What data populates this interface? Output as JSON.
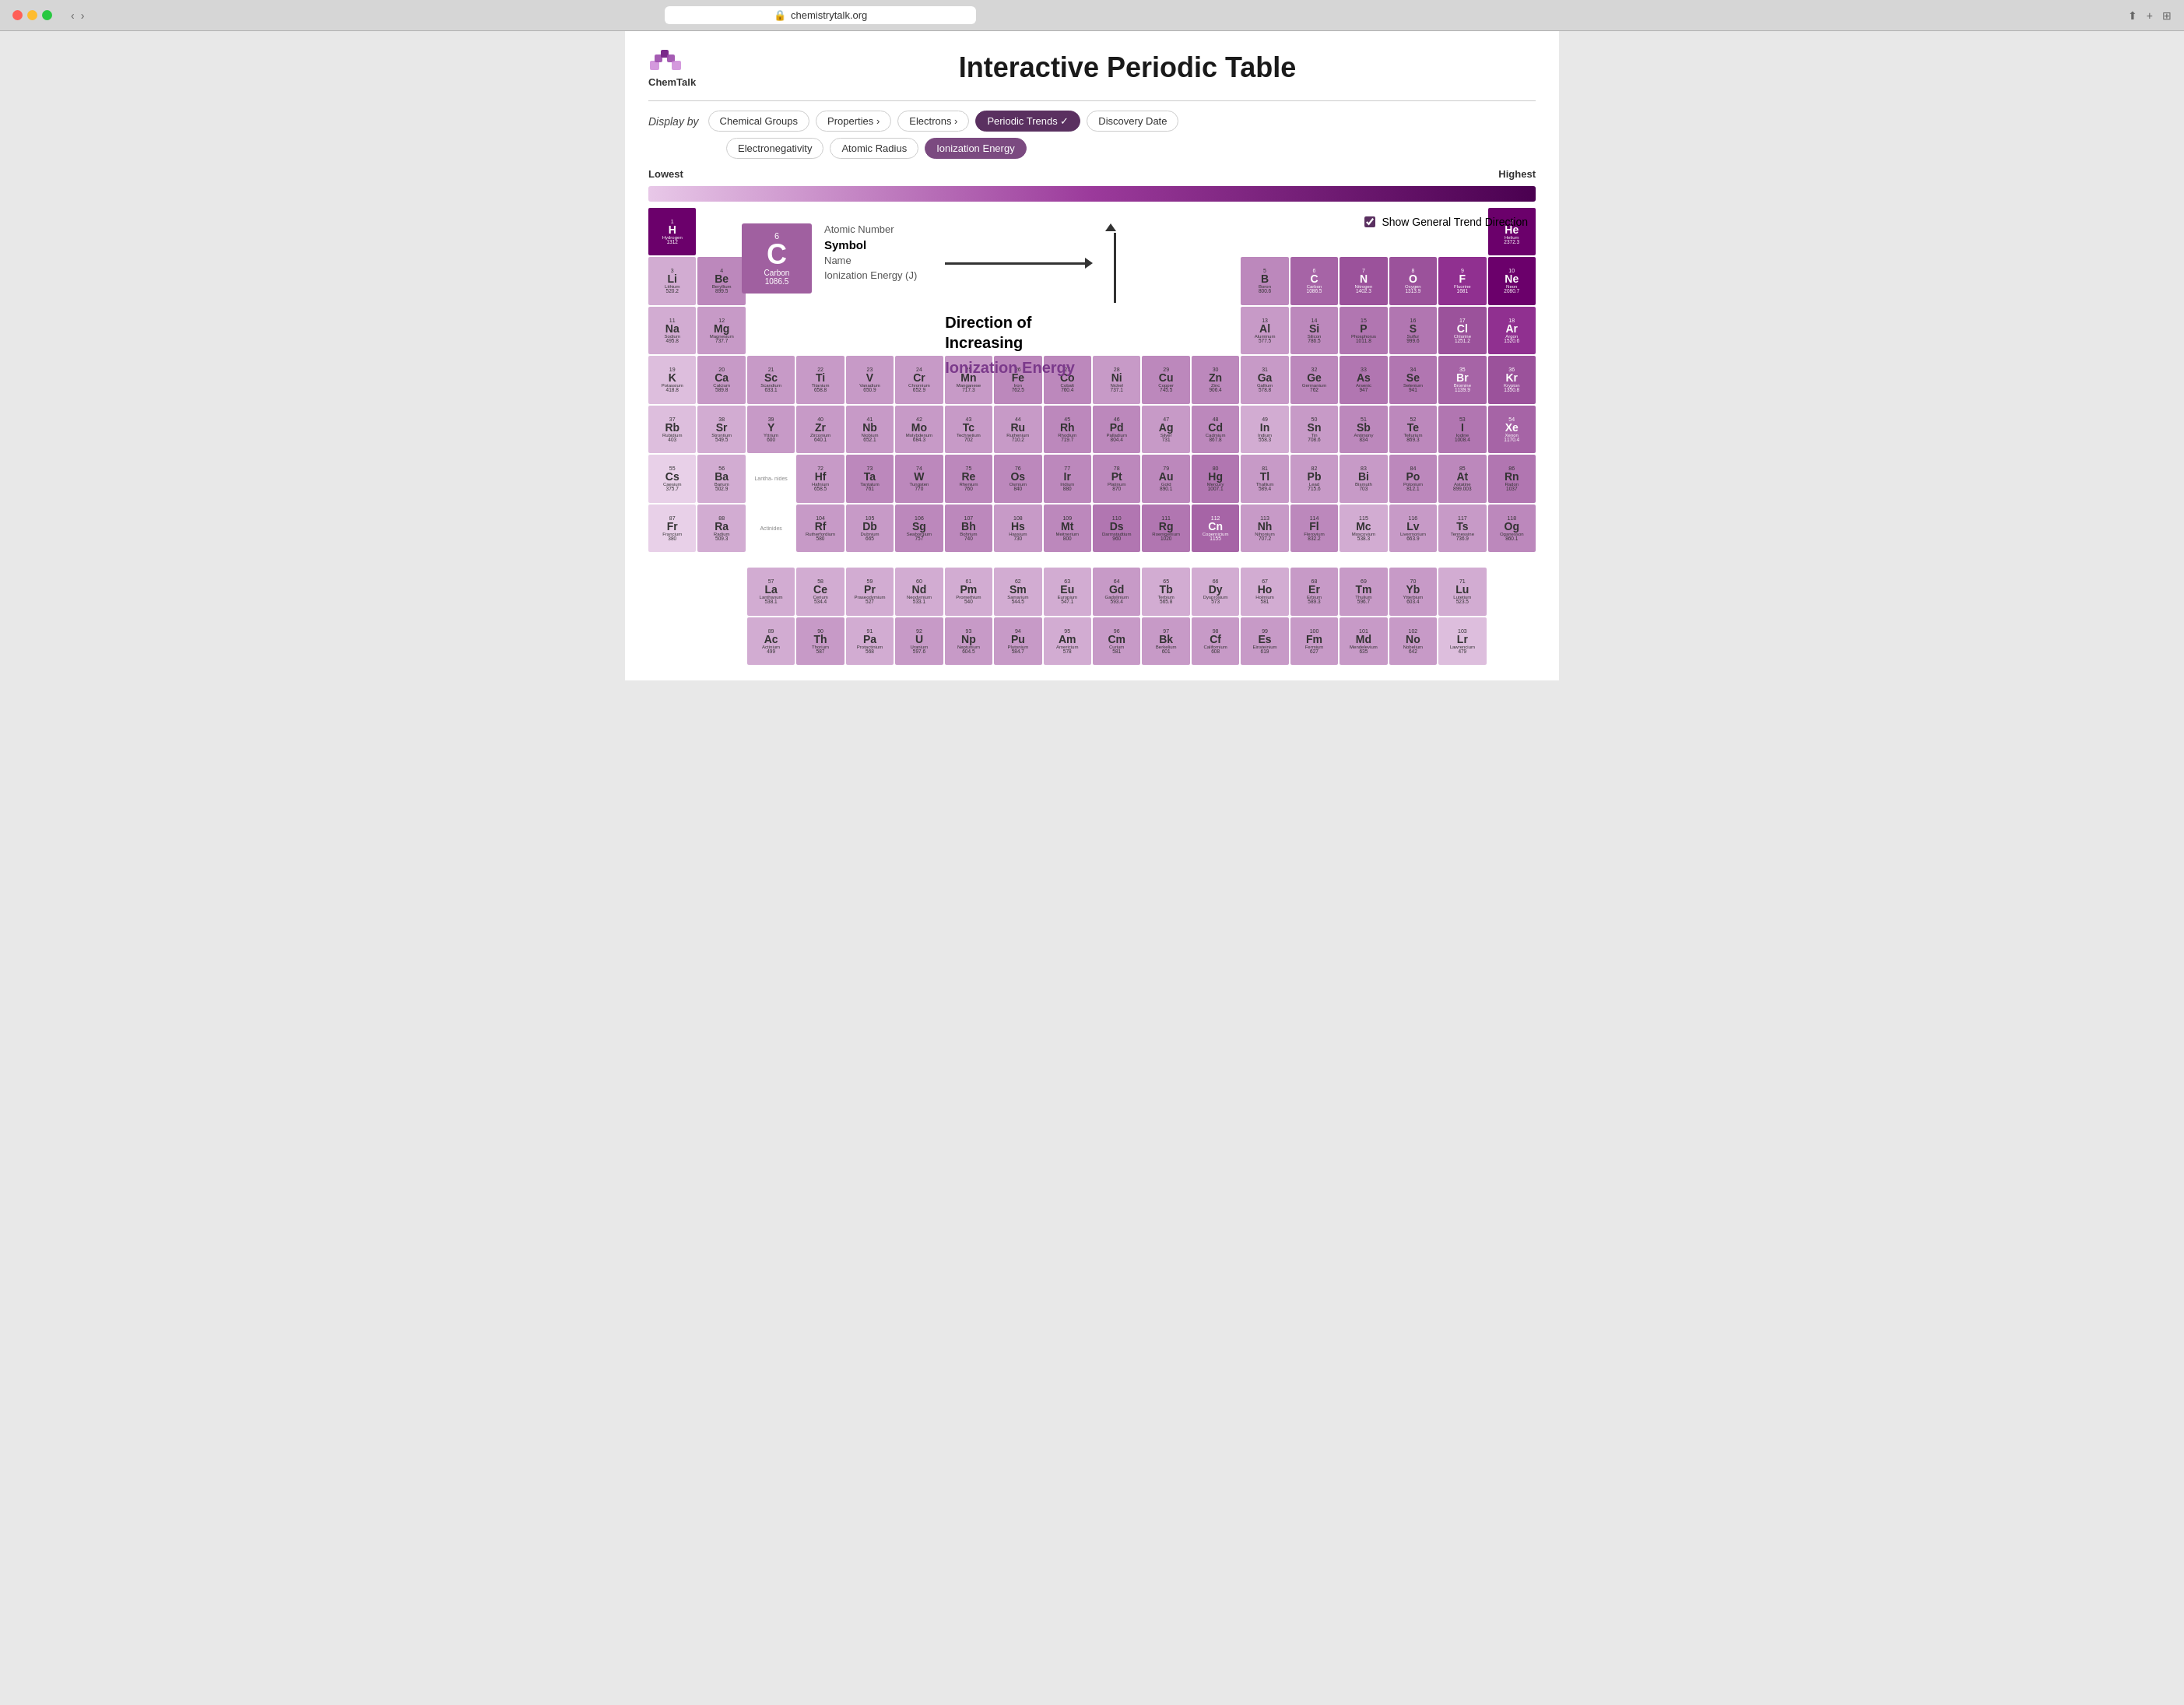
{
  "browser": {
    "url": "chemistrytalk.org"
  },
  "header": {
    "logo_text": "ChemTalk",
    "title": "Interactive Periodic Table"
  },
  "filters": {
    "display_by_label": "Display by",
    "buttons": [
      {
        "label": "Chemical Groups",
        "state": "normal"
      },
      {
        "label": "Properties ›",
        "state": "normal"
      },
      {
        "label": "Electrons ›",
        "state": "normal"
      },
      {
        "label": "Periodic Trends ✓",
        "state": "active"
      },
      {
        "label": "Discovery Date",
        "state": "normal"
      }
    ],
    "sub_buttons": [
      {
        "label": "Electronegativity",
        "state": "normal"
      },
      {
        "label": "Atomic Radius",
        "state": "normal"
      },
      {
        "label": "Ionization Energy",
        "state": "active-sub"
      }
    ]
  },
  "gradient": {
    "low_label": "Lowest",
    "high_label": "Highest"
  },
  "legend_element": {
    "atomic_number": "6",
    "symbol": "C",
    "name": "Carbon",
    "ie_value": "1086.5",
    "fields": [
      {
        "label": "Atomic Number",
        "value": ""
      },
      {
        "label": "Symbol",
        "value": ""
      },
      {
        "label": "Name",
        "value": ""
      },
      {
        "label": "Ionization Energy (J)",
        "value": ""
      }
    ]
  },
  "trend": {
    "direction_text": "Direction of\nIncreasing",
    "ie_label": "Ionization Energy"
  },
  "show_trend": {
    "label": "Show General Trend Direction",
    "checked": true
  },
  "elements": [
    {
      "num": 1,
      "sym": "H",
      "name": "Hydrogen",
      "ie": 1312,
      "col": 1,
      "row": 1,
      "tier": "ie-10"
    },
    {
      "num": 2,
      "sym": "He",
      "name": "Helium",
      "ie": 2372.3,
      "col": 18,
      "row": 1,
      "tier": "ie-10"
    },
    {
      "num": 3,
      "sym": "Li",
      "name": "Lithium",
      "ie": 520.2,
      "col": 1,
      "row": 2,
      "tier": "ie-3"
    },
    {
      "num": 4,
      "sym": "Be",
      "name": "Beryllium",
      "ie": 899.5,
      "col": 2,
      "row": 2,
      "tier": "ie-5"
    },
    {
      "num": 5,
      "sym": "B",
      "name": "Boron",
      "ie": 800.6,
      "col": 13,
      "row": 2,
      "tier": "ie-5"
    },
    {
      "num": 6,
      "sym": "C",
      "name": "Carbon",
      "ie": 1086.5,
      "col": 14,
      "row": 2,
      "tier": "ie-7"
    },
    {
      "num": 7,
      "sym": "N",
      "name": "Nitrogen",
      "ie": 1402.3,
      "col": 15,
      "row": 2,
      "tier": "ie-8"
    },
    {
      "num": 8,
      "sym": "O",
      "name": "Oxygen",
      "ie": 1313.9,
      "col": 16,
      "row": 2,
      "tier": "ie-8"
    },
    {
      "num": 9,
      "sym": "F",
      "name": "Fluorine",
      "ie": 1681,
      "col": 17,
      "row": 2,
      "tier": "ie-9"
    },
    {
      "num": 10,
      "sym": "Ne",
      "name": "Neon",
      "ie": 2080.7,
      "col": 18,
      "row": 2,
      "tier": "ie-10"
    },
    {
      "num": 11,
      "sym": "Na",
      "name": "Sodium",
      "ie": 495.8,
      "col": 1,
      "row": 3,
      "tier": "ie-3"
    },
    {
      "num": 12,
      "sym": "Mg",
      "name": "Magnesium",
      "ie": 737.7,
      "col": 2,
      "row": 3,
      "tier": "ie-4"
    },
    {
      "num": 13,
      "sym": "Al",
      "name": "Aluminum",
      "ie": 577.5,
      "col": 13,
      "row": 3,
      "tier": "ie-4"
    },
    {
      "num": 14,
      "sym": "Si",
      "name": "Silicon",
      "ie": 786.5,
      "col": 14,
      "row": 3,
      "tier": "ie-5"
    },
    {
      "num": 15,
      "sym": "P",
      "name": "Phosphorus",
      "ie": 1011.8,
      "col": 15,
      "row": 3,
      "tier": "ie-6"
    },
    {
      "num": 16,
      "sym": "S",
      "name": "Sulfur",
      "ie": 999.6,
      "col": 16,
      "row": 3,
      "tier": "ie-6"
    },
    {
      "num": 17,
      "sym": "Cl",
      "name": "Chlorine",
      "ie": 1251.2,
      "col": 17,
      "row": 3,
      "tier": "ie-8"
    },
    {
      "num": 18,
      "sym": "Ar",
      "name": "Argon",
      "ie": 1520.6,
      "col": 18,
      "row": 3,
      "tier": "ie-9"
    },
    {
      "num": 19,
      "sym": "K",
      "name": "Potassium",
      "ie": 418.8,
      "col": 1,
      "row": 4,
      "tier": "ie-2"
    },
    {
      "num": 20,
      "sym": "Ca",
      "name": "Calcium",
      "ie": 589.8,
      "col": 2,
      "row": 4,
      "tier": "ie-4"
    },
    {
      "num": 21,
      "sym": "Sc",
      "name": "Scandium",
      "ie": 633.1,
      "col": 3,
      "row": 4,
      "tier": "ie-4"
    },
    {
      "num": 22,
      "sym": "Ti",
      "name": "Titanium",
      "ie": 658.8,
      "col": 4,
      "row": 4,
      "tier": "ie-4"
    },
    {
      "num": 23,
      "sym": "V",
      "name": "Vanadium",
      "ie": 650.9,
      "col": 5,
      "row": 4,
      "tier": "ie-4"
    },
    {
      "num": 24,
      "sym": "Cr",
      "name": "Chromium",
      "ie": 652.9,
      "col": 6,
      "row": 4,
      "tier": "ie-4"
    },
    {
      "num": 25,
      "sym": "Mn",
      "name": "Manganese",
      "ie": 717.3,
      "col": 7,
      "row": 4,
      "tier": "ie-4"
    },
    {
      "num": 26,
      "sym": "Fe",
      "name": "Iron",
      "ie": 762.5,
      "col": 8,
      "row": 4,
      "tier": "ie-5"
    },
    {
      "num": 27,
      "sym": "Co",
      "name": "Cobalt",
      "ie": 760.4,
      "col": 9,
      "row": 4,
      "tier": "ie-5"
    },
    {
      "num": 28,
      "sym": "Ni",
      "name": "Nickel",
      "ie": 737.1,
      "col": 10,
      "row": 4,
      "tier": "ie-4"
    },
    {
      "num": 29,
      "sym": "Cu",
      "name": "Copper",
      "ie": 745.5,
      "col": 11,
      "row": 4,
      "tier": "ie-5"
    },
    {
      "num": 30,
      "sym": "Zn",
      "name": "Zinc",
      "ie": 906.4,
      "col": 12,
      "row": 4,
      "tier": "ie-5"
    },
    {
      "num": 31,
      "sym": "Ga",
      "name": "Gallium",
      "ie": 578.8,
      "col": 13,
      "row": 4,
      "tier": "ie-4"
    },
    {
      "num": 32,
      "sym": "Ge",
      "name": "Germanium",
      "ie": 762,
      "col": 14,
      "row": 4,
      "tier": "ie-5"
    },
    {
      "num": 33,
      "sym": "As",
      "name": "Arsenic",
      "ie": 947,
      "col": 15,
      "row": 4,
      "tier": "ie-6"
    },
    {
      "num": 34,
      "sym": "Se",
      "name": "Selenium",
      "ie": 941,
      "col": 16,
      "row": 4,
      "tier": "ie-6"
    },
    {
      "num": 35,
      "sym": "Br",
      "name": "Bromine",
      "ie": 1139.9,
      "col": 17,
      "row": 4,
      "tier": "ie-7"
    },
    {
      "num": 36,
      "sym": "Kr",
      "name": "Krypton",
      "ie": 1350.8,
      "col": 18,
      "row": 4,
      "tier": "ie-8"
    },
    {
      "num": 37,
      "sym": "Rb",
      "name": "Rubidium",
      "ie": 403,
      "col": 1,
      "row": 5,
      "tier": "ie-2"
    },
    {
      "num": 38,
      "sym": "Sr",
      "name": "Strontium",
      "ie": 549.5,
      "col": 2,
      "row": 5,
      "tier": "ie-3"
    },
    {
      "num": 39,
      "sym": "Y",
      "name": "Yttrium",
      "ie": 600,
      "col": 3,
      "row": 5,
      "tier": "ie-4"
    },
    {
      "num": 40,
      "sym": "Zr",
      "name": "Zirconium",
      "ie": 640.1,
      "col": 4,
      "row": 5,
      "tier": "ie-4"
    },
    {
      "num": 41,
      "sym": "Nb",
      "name": "Niobium",
      "ie": 652.1,
      "col": 5,
      "row": 5,
      "tier": "ie-4"
    },
    {
      "num": 42,
      "sym": "Mo",
      "name": "Molybdenum",
      "ie": 684.3,
      "col": 6,
      "row": 5,
      "tier": "ie-4"
    },
    {
      "num": 43,
      "sym": "Tc",
      "name": "Technetium",
      "ie": 702,
      "col": 7,
      "row": 5,
      "tier": "ie-4"
    },
    {
      "num": 44,
      "sym": "Ru",
      "name": "Ruthenium",
      "ie": 710.2,
      "col": 8,
      "row": 5,
      "tier": "ie-4"
    },
    {
      "num": 45,
      "sym": "Rh",
      "name": "Rhodium",
      "ie": 719.7,
      "col": 9,
      "row": 5,
      "tier": "ie-5"
    },
    {
      "num": 46,
      "sym": "Pd",
      "name": "Palladium",
      "ie": 804.4,
      "col": 10,
      "row": 5,
      "tier": "ie-5"
    },
    {
      "num": 47,
      "sym": "Ag",
      "name": "Silver",
      "ie": 731,
      "col": 11,
      "row": 5,
      "tier": "ie-4"
    },
    {
      "num": 48,
      "sym": "Cd",
      "name": "Cadmium",
      "ie": 867.8,
      "col": 12,
      "row": 5,
      "tier": "ie-5"
    },
    {
      "num": 49,
      "sym": "In",
      "name": "Indium",
      "ie": 558.3,
      "col": 13,
      "row": 5,
      "tier": "ie-3"
    },
    {
      "num": 50,
      "sym": "Sn",
      "name": "Tin",
      "ie": 708.6,
      "col": 14,
      "row": 5,
      "tier": "ie-4"
    },
    {
      "num": 51,
      "sym": "Sb",
      "name": "Antimony",
      "ie": 834,
      "col": 15,
      "row": 5,
      "tier": "ie-5"
    },
    {
      "num": 52,
      "sym": "Te",
      "name": "Tellurium",
      "ie": 869.3,
      "col": 16,
      "row": 5,
      "tier": "ie-5"
    },
    {
      "num": 53,
      "sym": "I",
      "name": "Iodine",
      "ie": 1008.4,
      "col": 17,
      "row": 5,
      "tier": "ie-6"
    },
    {
      "num": 54,
      "sym": "Xe",
      "name": "Xenon",
      "ie": 1170.4,
      "col": 18,
      "row": 5,
      "tier": "ie-7"
    },
    {
      "num": 55,
      "sym": "Cs",
      "name": "Caesium",
      "ie": 375.7,
      "col": 1,
      "row": 6,
      "tier": "ie-1"
    },
    {
      "num": 56,
      "sym": "Ba",
      "name": "Barium",
      "ie": 502.9,
      "col": 2,
      "row": 6,
      "tier": "ie-3"
    },
    {
      "num": 72,
      "sym": "Hf",
      "name": "Hafnium",
      "ie": 658.5,
      "col": 4,
      "row": 6,
      "tier": "ie-4"
    },
    {
      "num": 73,
      "sym": "Ta",
      "name": "Tantalum",
      "ie": 761,
      "col": 5,
      "row": 6,
      "tier": "ie-5"
    },
    {
      "num": 74,
      "sym": "W",
      "name": "Tungsten",
      "ie": 770,
      "col": 6,
      "row": 6,
      "tier": "ie-5"
    },
    {
      "num": 75,
      "sym": "Re",
      "name": "Rhenium",
      "ie": 760,
      "col": 7,
      "row": 6,
      "tier": "ie-5"
    },
    {
      "num": 76,
      "sym": "Os",
      "name": "Osmium",
      "ie": 840,
      "col": 8,
      "row": 6,
      "tier": "ie-5"
    },
    {
      "num": 77,
      "sym": "Ir",
      "name": "Iridium",
      "ie": 880,
      "col": 9,
      "row": 6,
      "tier": "ie-5"
    },
    {
      "num": 78,
      "sym": "Pt",
      "name": "Platinum",
      "ie": 870,
      "col": 10,
      "row": 6,
      "tier": "ie-5"
    },
    {
      "num": 79,
      "sym": "Au",
      "name": "Gold",
      "ie": 890.1,
      "col": 11,
      "row": 6,
      "tier": "ie-5"
    },
    {
      "num": 80,
      "sym": "Hg",
      "name": "Mercury",
      "ie": 1007.1,
      "col": 12,
      "row": 6,
      "tier": "ie-6"
    },
    {
      "num": 81,
      "sym": "Tl",
      "name": "Thallium",
      "ie": 589.4,
      "col": 13,
      "row": 6,
      "tier": "ie-4"
    },
    {
      "num": 82,
      "sym": "Pb",
      "name": "Lead",
      "ie": 715.6,
      "col": 14,
      "row": 6,
      "tier": "ie-4"
    },
    {
      "num": 83,
      "sym": "Bi",
      "name": "Bismuth",
      "ie": 703,
      "col": 15,
      "row": 6,
      "tier": "ie-4"
    },
    {
      "num": 84,
      "sym": "Po",
      "name": "Polonium",
      "ie": 812.1,
      "col": 16,
      "row": 6,
      "tier": "ie-5"
    },
    {
      "num": 85,
      "sym": "At",
      "name": "Astatine",
      "ie": 899.003,
      "col": 17,
      "row": 6,
      "tier": "ie-5"
    },
    {
      "num": 86,
      "sym": "Rn",
      "name": "Radon",
      "ie": 1037,
      "col": 18,
      "row": 6,
      "tier": "ie-6"
    },
    {
      "num": 87,
      "sym": "Fr",
      "name": "Francium",
      "ie": 380,
      "col": 1,
      "row": 7,
      "tier": "ie-1"
    },
    {
      "num": 88,
      "sym": "Ra",
      "name": "Radium",
      "ie": 509.3,
      "col": 2,
      "row": 7,
      "tier": "ie-3"
    },
    {
      "num": 104,
      "sym": "Rf",
      "name": "Rutherfordium",
      "ie": 580,
      "col": 4,
      "row": 7,
      "tier": "ie-4"
    },
    {
      "num": 105,
      "sym": "Db",
      "name": "Dubnium",
      "ie": 665,
      "col": 5,
      "row": 7,
      "tier": "ie-4"
    },
    {
      "num": 106,
      "sym": "Sg",
      "name": "Seaborgium",
      "ie": 757,
      "col": 6,
      "row": 7,
      "tier": "ie-5"
    },
    {
      "num": 107,
      "sym": "Bh",
      "name": "Bohrium",
      "ie": 740,
      "col": 7,
      "row": 7,
      "tier": "ie-5"
    },
    {
      "num": 108,
      "sym": "Hs",
      "name": "Hassium",
      "ie": 730,
      "col": 8,
      "row": 7,
      "tier": "ie-4"
    },
    {
      "num": 109,
      "sym": "Mt",
      "name": "Meitnerium",
      "ie": 800,
      "col": 9,
      "row": 7,
      "tier": "ie-5"
    },
    {
      "num": 110,
      "sym": "Ds",
      "name": "Darmstadtium",
      "ie": 960,
      "col": 10,
      "row": 7,
      "tier": "ie-6"
    },
    {
      "num": 111,
      "sym": "Rg",
      "name": "Roentgenium",
      "ie": 1020,
      "col": 11,
      "row": 7,
      "tier": "ie-6"
    },
    {
      "num": 112,
      "sym": "Cn",
      "name": "Copernicium",
      "ie": 1155,
      "col": 12,
      "row": 7,
      "tier": "ie-7"
    },
    {
      "num": 113,
      "sym": "Nh",
      "name": "Nihonium",
      "ie": 707.2,
      "col": 13,
      "row": 7,
      "tier": "ie-4"
    },
    {
      "num": 114,
      "sym": "Fl",
      "name": "Flerovium",
      "ie": 832.2,
      "col": 14,
      "row": 7,
      "tier": "ie-5"
    },
    {
      "num": 115,
      "sym": "Mc",
      "name": "Moscovium",
      "ie": 538.3,
      "col": 15,
      "row": 7,
      "tier": "ie-3"
    },
    {
      "num": 116,
      "sym": "Lv",
      "name": "Livermorium",
      "ie": 663.9,
      "col": 16,
      "row": 7,
      "tier": "ie-4"
    },
    {
      "num": 117,
      "sym": "Ts",
      "name": "Tennessine",
      "ie": 736.9,
      "col": 17,
      "row": 7,
      "tier": "ie-4"
    },
    {
      "num": 118,
      "sym": "Og",
      "name": "Oganesson",
      "ie": 860.1,
      "col": 18,
      "row": 7,
      "tier": "ie-5"
    },
    {
      "num": 57,
      "sym": "La",
      "name": "Lanthanum",
      "ie": 538.1,
      "col": 3,
      "row": "La",
      "tier": "ie-3"
    },
    {
      "num": 58,
      "sym": "Ce",
      "name": "Cerium",
      "ie": 534.4,
      "col": 4,
      "row": "La",
      "tier": "ie-3"
    },
    {
      "num": 59,
      "sym": "Pr",
      "name": "Praseodymium",
      "ie": 527,
      "col": 5,
      "row": "La",
      "tier": "ie-3"
    },
    {
      "num": 60,
      "sym": "Nd",
      "name": "Neodymium",
      "ie": 533.1,
      "col": 6,
      "row": "La",
      "tier": "ie-3"
    },
    {
      "num": 61,
      "sym": "Pm",
      "name": "Promethium",
      "ie": 540,
      "col": 7,
      "row": "La",
      "tier": "ie-3"
    },
    {
      "num": 62,
      "sym": "Sm",
      "name": "Samarium",
      "ie": 544.5,
      "col": 8,
      "row": "La",
      "tier": "ie-3"
    },
    {
      "num": 63,
      "sym": "Eu",
      "name": "Europium",
      "ie": 547.1,
      "col": 9,
      "row": "La",
      "tier": "ie-3"
    },
    {
      "num": 64,
      "sym": "Gd",
      "name": "Gadolinium",
      "ie": 593.4,
      "col": 10,
      "row": "La",
      "tier": "ie-4"
    },
    {
      "num": 65,
      "sym": "Tb",
      "name": "Terbium",
      "ie": 565.8,
      "col": 11,
      "row": "La",
      "tier": "ie-3"
    },
    {
      "num": 66,
      "sym": "Dy",
      "name": "Dysprosium",
      "ie": 573,
      "col": 12,
      "row": "La",
      "tier": "ie-3"
    },
    {
      "num": 67,
      "sym": "Ho",
      "name": "Holmium",
      "ie": 581,
      "col": 13,
      "row": "La",
      "tier": "ie-3"
    },
    {
      "num": 68,
      "sym": "Er",
      "name": "Erbium",
      "ie": 589.3,
      "col": 14,
      "row": "La",
      "tier": "ie-4"
    },
    {
      "num": 69,
      "sym": "Tm",
      "name": "Thulium",
      "ie": 596.7,
      "col": 15,
      "row": "La",
      "tier": "ie-4"
    },
    {
      "num": 70,
      "sym": "Yb",
      "name": "Ytterbium",
      "ie": 603.4,
      "col": 16,
      "row": "La",
      "tier": "ie-4"
    },
    {
      "num": 71,
      "sym": "Lu",
      "name": "Lutetium",
      "ie": 523.5,
      "col": 17,
      "row": "La",
      "tier": "ie-3"
    },
    {
      "num": 89,
      "sym": "Ac",
      "name": "Actinium",
      "ie": 499,
      "col": 3,
      "row": "Ac",
      "tier": "ie-3"
    },
    {
      "num": 90,
      "sym": "Th",
      "name": "Thorium",
      "ie": 587,
      "col": 4,
      "row": "Ac",
      "tier": "ie-4"
    },
    {
      "num": 91,
      "sym": "Pa",
      "name": "Protactinium",
      "ie": 568,
      "col": 5,
      "row": "Ac",
      "tier": "ie-3"
    },
    {
      "num": 92,
      "sym": "U",
      "name": "Uranium",
      "ie": 597.6,
      "col": 6,
      "row": "Ac",
      "tier": "ie-4"
    },
    {
      "num": 93,
      "sym": "Np",
      "name": "Neptunium",
      "ie": 604.5,
      "col": 7,
      "row": "Ac",
      "tier": "ie-4"
    },
    {
      "num": 94,
      "sym": "Pu",
      "name": "Plutonium",
      "ie": 584.7,
      "col": 8,
      "row": "Ac",
      "tier": "ie-4"
    },
    {
      "num": 95,
      "sym": "Am",
      "name": "Americium",
      "ie": 578,
      "col": 9,
      "row": "Ac",
      "tier": "ie-3"
    },
    {
      "num": 96,
      "sym": "Cm",
      "name": "Curium",
      "ie": 581,
      "col": 10,
      "row": "Ac",
      "tier": "ie-4"
    },
    {
      "num": 97,
      "sym": "Bk",
      "name": "Berkelium",
      "ie": 601,
      "col": 11,
      "row": "Ac",
      "tier": "ie-4"
    },
    {
      "num": 98,
      "sym": "Cf",
      "name": "Californium",
      "ie": 608,
      "col": 12,
      "row": "Ac",
      "tier": "ie-4"
    },
    {
      "num": 99,
      "sym": "Es",
      "name": "Einsteinium",
      "ie": 619,
      "col": 13,
      "row": "Ac",
      "tier": "ie-4"
    },
    {
      "num": 100,
      "sym": "Fm",
      "name": "Fermium",
      "ie": 627,
      "col": 14,
      "row": "Ac",
      "tier": "ie-4"
    },
    {
      "num": 101,
      "sym": "Md",
      "name": "Mendelevium",
      "ie": 635,
      "col": 15,
      "row": "Ac",
      "tier": "ie-4"
    },
    {
      "num": 102,
      "sym": "No",
      "name": "Nobelium",
      "ie": 642,
      "col": 16,
      "row": "Ac",
      "tier": "ie-4"
    },
    {
      "num": 103,
      "sym": "Lr",
      "name": "Lawrencium",
      "ie": 479,
      "col": 17,
      "row": "Ac",
      "tier": "ie-2"
    }
  ]
}
